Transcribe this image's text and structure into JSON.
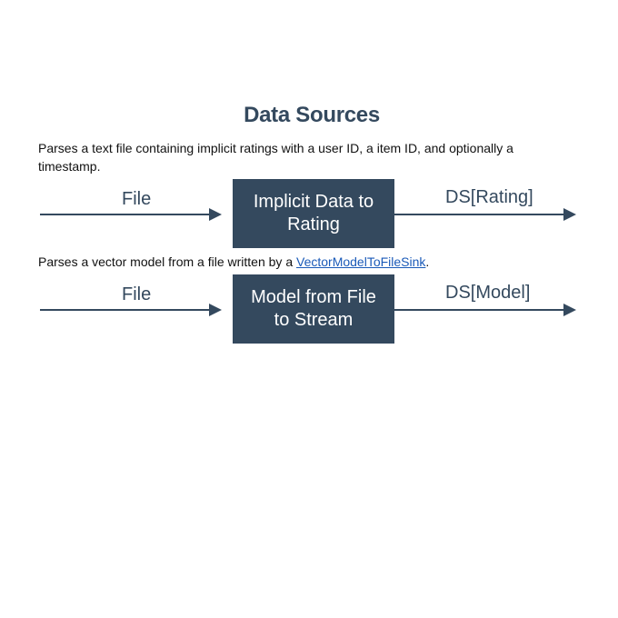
{
  "title": "Data Sources",
  "sources": [
    {
      "description": "Parses a text file containing implicit ratings with a user ID, a item ID, and optionally a timestamp.",
      "input_label": "File",
      "box_label": "Implicit Data to Rating",
      "output_label": "DS[Rating]"
    },
    {
      "description_prefix": "Parses a vector model from a file written by a ",
      "description_link": "VectorModelToFileSink",
      "description_suffix": ".",
      "input_label": "File",
      "box_label": "Model from File to Stream",
      "output_label": "DS[Model]"
    }
  ],
  "colors": {
    "box_fill": "#34495e",
    "box_text": "#ffffff",
    "arrow": "#34495e",
    "link": "#1a5ab8"
  }
}
